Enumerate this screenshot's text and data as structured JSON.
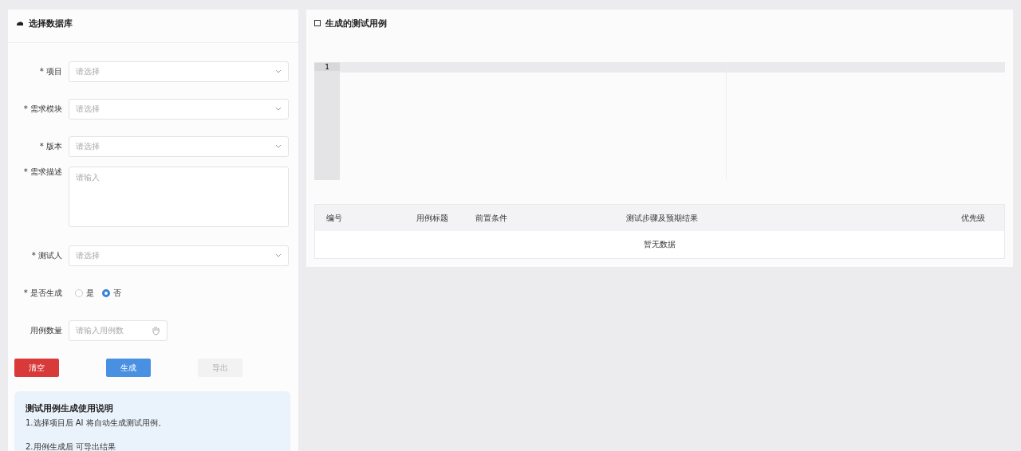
{
  "form_panel": {
    "title": "选择数据库",
    "fields": [
      {
        "kind": "select",
        "label": "* 项目",
        "placeholder": "请选择"
      },
      {
        "kind": "select",
        "label": "* 需求模块",
        "placeholder": "请选择"
      },
      {
        "kind": "select",
        "label": "* 版本",
        "placeholder": "请选择"
      },
      {
        "kind": "textarea",
        "label": "* 需求描述",
        "placeholder": "请输入"
      },
      {
        "kind": "select",
        "label": "* 测试人",
        "placeholder": "请选择"
      },
      {
        "kind": "radio",
        "label": "* 是否生成",
        "options": [
          {
            "label": "是",
            "selected": false
          },
          {
            "label": "否",
            "selected": true
          }
        ]
      },
      {
        "kind": "number",
        "label": "用例数量",
        "placeholder": "请输入用例数"
      }
    ],
    "buttons": [
      {
        "kind": "danger",
        "label": "清空",
        "disabled": false
      },
      {
        "kind": "primary",
        "label": "生成",
        "disabled": false
      },
      {
        "kind": "default",
        "label": "导出",
        "disabled": true
      }
    ],
    "info": {
      "title": "测试用例生成使用说明",
      "lines": [
        "1.选择项目后 AI 将自动生成测试用例。",
        "2.用例生成后 可导出结果"
      ]
    }
  },
  "result_panel": {
    "title": "生成的测试用例",
    "editor": {
      "line_numbers": [
        "1"
      ]
    },
    "table": {
      "columns": [
        "编号",
        "用例标题",
        "前置条件",
        "测试步骤及预期结果",
        "优先级"
      ],
      "empty_text": "暂无数据"
    }
  }
}
